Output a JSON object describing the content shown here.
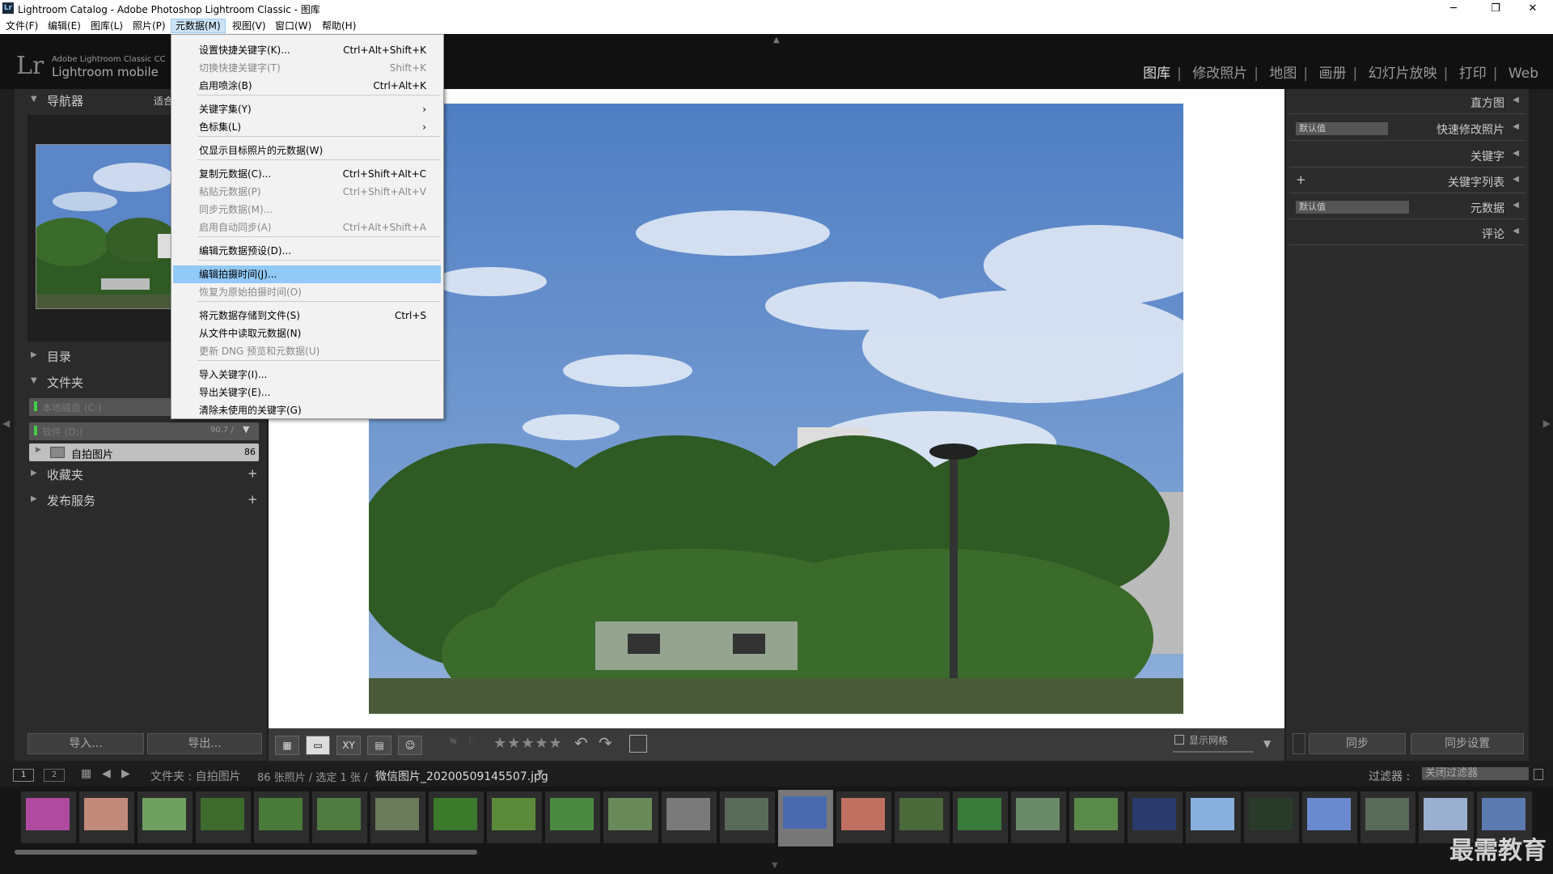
{
  "window": {
    "title": "Lightroom Catalog - Adobe Photoshop Lightroom Classic - 图库",
    "minimize": "─",
    "restore": "❐",
    "close": "✕"
  },
  "menubar": [
    "文件(F)",
    "编辑(E)",
    "图库(L)",
    "照片(P)",
    "元数据(M)",
    "视图(V)",
    "窗口(W)",
    "帮助(H)"
  ],
  "identity": {
    "logo": "Lr",
    "small": "Adobe Lightroom Classic CC",
    "large": "Lightroom mobile"
  },
  "modules": [
    "图库",
    "修改照片",
    "地图",
    "画册",
    "幻灯片放映",
    "打印",
    "Web"
  ],
  "left": {
    "navigator": "导航器",
    "fit": "适合",
    "catalog": "目录",
    "folders": "文件夹",
    "drive1": "本地磁盘 (C:)",
    "drive2": "软件 (D:)",
    "drive2_info": "90.7 /",
    "folder_name": "自拍图片",
    "folder_count": "86",
    "collections": "收藏夹",
    "publish": "发布服务",
    "import": "导入...",
    "export": "导出..."
  },
  "right": {
    "histogram": "直方图",
    "quick_develop": "快速修改照片",
    "preset_default": "默认值",
    "keywording": "关键字",
    "keyword_list": "关键字列表",
    "plus": "+",
    "metadata": "元数据",
    "metadata_default": "默认值",
    "comments": "评论",
    "sync": "同步",
    "sync_settings": "同步设置"
  },
  "toolbar": {
    "stars": "★★★★★",
    "show_grid": "显示网格"
  },
  "filmbar": {
    "tab1": "1",
    "tab2": "2",
    "source": "文件夹 : 自拍图片",
    "count": "86 张照片 / 选定 1 张 /",
    "filename": "微信图片_20200509145507.jpg",
    "filter_label": "过滤器 :",
    "filter_value": "关闭过滤器"
  },
  "menu": {
    "items": [
      {
        "label": "设置快捷关键字(K)...",
        "shortcut": "Ctrl+Alt+Shift+K",
        "disabled": false
      },
      {
        "label": "切换快捷关键字(T)",
        "shortcut": "Shift+K",
        "disabled": true
      },
      {
        "label": "启用喷涂(B)",
        "shortcut": "Ctrl+Alt+K",
        "disabled": false
      },
      {
        "label": "关键字集(Y)",
        "shortcut": "›",
        "disabled": false
      },
      {
        "label": "色标集(L)",
        "shortcut": "›",
        "disabled": false
      },
      {
        "label": "仅显示目标照片的元数据(W)",
        "shortcut": "",
        "disabled": false
      },
      {
        "label": "复制元数据(C)...",
        "shortcut": "Ctrl+Shift+Alt+C",
        "disabled": false
      },
      {
        "label": "粘贴元数据(P)",
        "shortcut": "Ctrl+Shift+Alt+V",
        "disabled": true
      },
      {
        "label": "同步元数据(M)...",
        "shortcut": "",
        "disabled": true
      },
      {
        "label": "启用自动同步(A)",
        "shortcut": "Ctrl+Alt+Shift+A",
        "disabled": true
      },
      {
        "label": "编辑元数据预设(D)...",
        "shortcut": "",
        "disabled": false
      },
      {
        "label": "编辑拍摄时间(J)...",
        "shortcut": "",
        "disabled": false
      },
      {
        "label": "恢复为原始拍摄时间(O)",
        "shortcut": "",
        "disabled": true
      },
      {
        "label": "将元数据存储到文件(S)",
        "shortcut": "Ctrl+S",
        "disabled": false
      },
      {
        "label": "从文件中读取元数据(N)",
        "shortcut": "",
        "disabled": false
      },
      {
        "label": "更新 DNG 预览和元数据(U)",
        "shortcut": "",
        "disabled": true
      },
      {
        "label": "导入关键字(I)...",
        "shortcut": "",
        "disabled": false
      },
      {
        "label": "导出关键字(E)...",
        "shortcut": "",
        "disabled": false
      },
      {
        "label": "清除未使用的关键字(G)",
        "shortcut": "",
        "disabled": false
      }
    ]
  },
  "watermark": "最需教育",
  "colors": {
    "sky": "#5b86c7",
    "cloud": "#e8eef8",
    "foliage": "#2f5a24",
    "highlight": "#91c9f7"
  }
}
